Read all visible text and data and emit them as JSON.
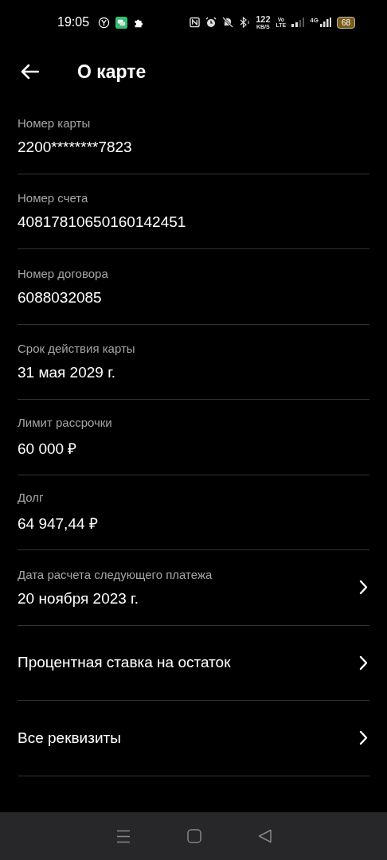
{
  "status_bar": {
    "time": "19:05",
    "speed": "122",
    "speed_unit": "KB/S",
    "volte_top": "Vo",
    "volte_bottom": "LTE",
    "network": "4G",
    "battery": "68"
  },
  "header": {
    "title": "О карте"
  },
  "items": [
    {
      "label": "Номер карты",
      "value": "2200********7823",
      "chevron": false
    },
    {
      "label": "Номер счета",
      "value": "40817810650160142451",
      "chevron": false
    },
    {
      "label": "Номер договора",
      "value": "6088032085",
      "chevron": false
    },
    {
      "label": "Срок действия карты",
      "value": "31 мая 2029 г.",
      "chevron": false
    },
    {
      "label": "Лимит рассрочки",
      "value": "60 000 ₽",
      "chevron": false
    },
    {
      "label": "Долг",
      "value": "64 947,44 ₽",
      "chevron": false
    },
    {
      "label": "Дата расчета следующего платежа",
      "value": "20 ноября 2023 г.",
      "chevron": true
    },
    {
      "title": "Процентная ставка на остаток",
      "chevron": true
    },
    {
      "title": "Все реквизиты",
      "chevron": true
    }
  ]
}
